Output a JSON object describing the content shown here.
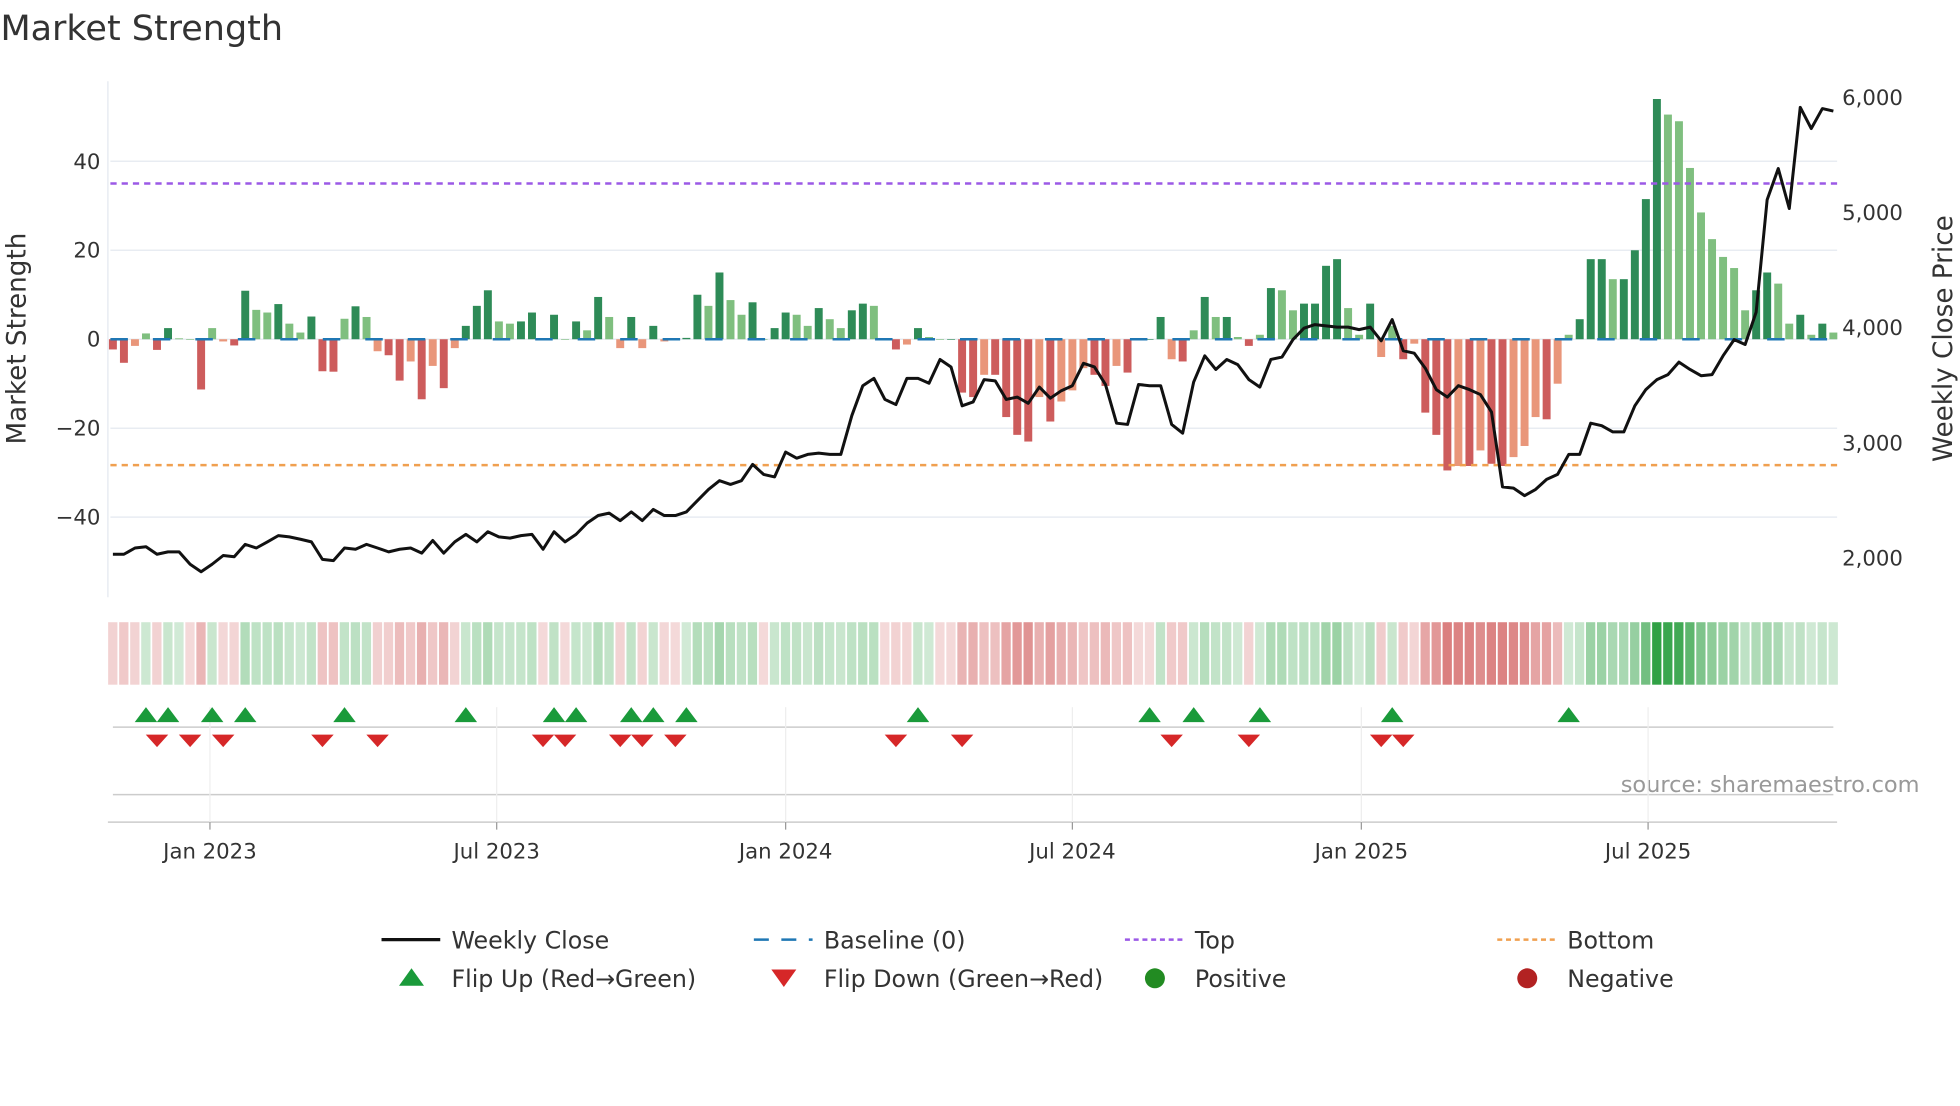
{
  "chart_data": {
    "type": "bar",
    "title": "Market Strength",
    "ylabel": "Market Strength",
    "y2label": "Weekly Close Price",
    "ylim": [
      -58,
      58
    ],
    "y2lim": [
      1660,
      6140
    ],
    "yticks": [
      {
        "v": 40,
        "label": "40"
      },
      {
        "v": 20,
        "label": "20"
      },
      {
        "v": 0,
        "label": "0"
      },
      {
        "v": -20,
        "label": "−20"
      },
      {
        "v": -40,
        "label": "−40"
      }
    ],
    "y2ticks": [
      {
        "v": 6000,
        "label": "6,000"
      },
      {
        "v": 5000,
        "label": "5,000"
      },
      {
        "v": 4000,
        "label": "4,000"
      },
      {
        "v": 3000,
        "label": "3,000"
      },
      {
        "v": 2000,
        "label": "2,000"
      }
    ],
    "xticks": [
      {
        "week": 8.8,
        "label": "Jan 2023"
      },
      {
        "week": 34.8,
        "label": "Jul 2023"
      },
      {
        "week": 61.0,
        "label": "Jan 2024"
      },
      {
        "week": 87.0,
        "label": "Jul 2024"
      },
      {
        "week": 113.2,
        "label": "Jan 2025"
      },
      {
        "week": 139.2,
        "label": "Jul 2025"
      }
    ],
    "top_level": 35,
    "bottom_level": -28.3,
    "baseline": 0,
    "strength": [
      -2.3,
      -5.3,
      -1.5,
      1.3,
      -2.4,
      2.5,
      0.2,
      0,
      -11.3,
      2.5,
      -0.5,
      -1.4,
      10.9,
      6.6,
      6.0,
      7.9,
      3.5,
      1.5,
      5.1,
      -7.2,
      -7.3,
      4.6,
      7.4,
      5.0,
      -2.7,
      -3.6,
      -9.3,
      -5,
      -13.5,
      -6,
      -11,
      -2,
      3,
      7.5,
      11,
      4,
      3.5,
      4,
      6,
      0,
      5.5,
      0,
      4,
      2,
      9.5,
      5,
      -2,
      5,
      -2,
      3,
      -0.5,
      0,
      0.3,
      10,
      7.5,
      15,
      8.8,
      5.5,
      8.3,
      0,
      2.5,
      6,
      5.5,
      3,
      7,
      4.5,
      2.5,
      6.5,
      8,
      7.5,
      0,
      -2.3,
      -1.2,
      2.5,
      0.5,
      0,
      0,
      -12,
      -13,
      -8,
      -8,
      -17.5,
      -21.5,
      -23,
      -13,
      -18.5,
      -14,
      -11.5,
      -6.5,
      -8,
      -10.5,
      -6,
      -7.5,
      0,
      0,
      5,
      -4.5,
      -5,
      2,
      9.5,
      5,
      5,
      0.5,
      -1.5,
      1,
      11.5,
      11,
      6.5,
      8,
      8,
      16.5,
      18,
      7,
      1,
      8,
      -4,
      3,
      -4.5,
      -1,
      -16.5,
      -21.5,
      -29.5,
      -28.5,
      -28.5,
      -25,
      -28,
      -28.5,
      -26.5,
      -24,
      -17.5,
      -18,
      -10,
      1,
      4.5,
      18,
      18,
      13.5,
      13.5,
      20,
      31.5,
      54,
      50.5,
      49,
      38.5,
      28.5,
      22.5,
      18.5,
      16,
      6.5,
      11,
      15,
      12.5,
      3.5,
      5.5,
      1,
      3.5,
      1.5
    ],
    "weekly_close": [
      2033,
      2033,
      2087,
      2098,
      2033,
      2054,
      2054,
      1946,
      1881,
      1946,
      2022,
      2011,
      2119,
      2087,
      2141,
      2195,
      2184,
      2163,
      2141,
      1989,
      1978,
      2087,
      2076,
      2119,
      2087,
      2054,
      2076,
      2087,
      2043,
      2152,
      2043,
      2141,
      2206,
      2141,
      2228,
      2184,
      2173,
      2195,
      2206,
      2076,
      2228,
      2141,
      2206,
      2304,
      2369,
      2390,
      2325,
      2401,
      2325,
      2423,
      2369,
      2369,
      2401,
      2499,
      2596,
      2672,
      2640,
      2672,
      2813,
      2726,
      2705,
      2921,
      2867,
      2900,
      2911,
      2900,
      2900,
      3236,
      3496,
      3561,
      3377,
      3333,
      3561,
      3561,
      3518,
      3724,
      3659,
      3322,
      3355,
      3550,
      3539,
      3377,
      3398,
      3344,
      3485,
      3388,
      3453,
      3496,
      3691,
      3659,
      3507,
      3171,
      3160,
      3507,
      3496,
      3496,
      3160,
      3084,
      3528,
      3756,
      3637,
      3724,
      3680,
      3550,
      3485,
      3724,
      3745,
      3897,
      3995,
      4027,
      4016,
      4005,
      4005,
      3984,
      4005,
      3886,
      4070,
      3799,
      3778,
      3648,
      3463,
      3398,
      3496,
      3463,
      3420,
      3268,
      2618,
      2607,
      2542,
      2596,
      2683,
      2726,
      2900,
      2900,
      3171,
      3149,
      3095,
      3095,
      3322,
      3463,
      3550,
      3593,
      3702,
      3637,
      3583,
      3593,
      3756,
      3897,
      3854,
      4135,
      5111,
      5382,
      5035,
      5913,
      5729,
      5902,
      5881
    ],
    "flip_up_weeks": [
      3,
      5,
      9,
      12,
      21,
      32,
      40,
      42,
      47,
      49,
      52,
      73,
      94,
      98,
      104,
      116,
      132
    ],
    "flip_down_weeks": [
      4,
      7,
      10,
      19,
      24,
      39,
      41,
      46,
      48,
      51,
      71,
      77,
      96,
      103,
      115,
      117
    ],
    "colors": {
      "pos_strong": "#2e8b57",
      "pos_weak": "#7fbf7f",
      "neg_strong": "#cd5c5c",
      "neg_weak": "#e9967a",
      "line": "#111111",
      "baseline": "#1f77b4",
      "top": "#9b59e6",
      "bottom": "#f0a050",
      "flip_up": "#1a9a3a",
      "flip_down": "#d62728",
      "positive": "#228b22",
      "negative": "#b22222"
    },
    "legend": [
      {
        "label": "Weekly Close",
        "kind": "line"
      },
      {
        "label": "Baseline (0)",
        "kind": "baseline"
      },
      {
        "label": "Top",
        "kind": "top"
      },
      {
        "label": "Bottom",
        "kind": "bottom"
      },
      {
        "label": "Flip Up (Red→Green)",
        "kind": "up"
      },
      {
        "label": "Flip Down (Green→Red)",
        "kind": "down"
      },
      {
        "label": "Positive",
        "kind": "pos"
      },
      {
        "label": "Negative",
        "kind": "neg"
      }
    ],
    "legend_placement": "bottom",
    "source": "source: sharemaestro.com"
  }
}
